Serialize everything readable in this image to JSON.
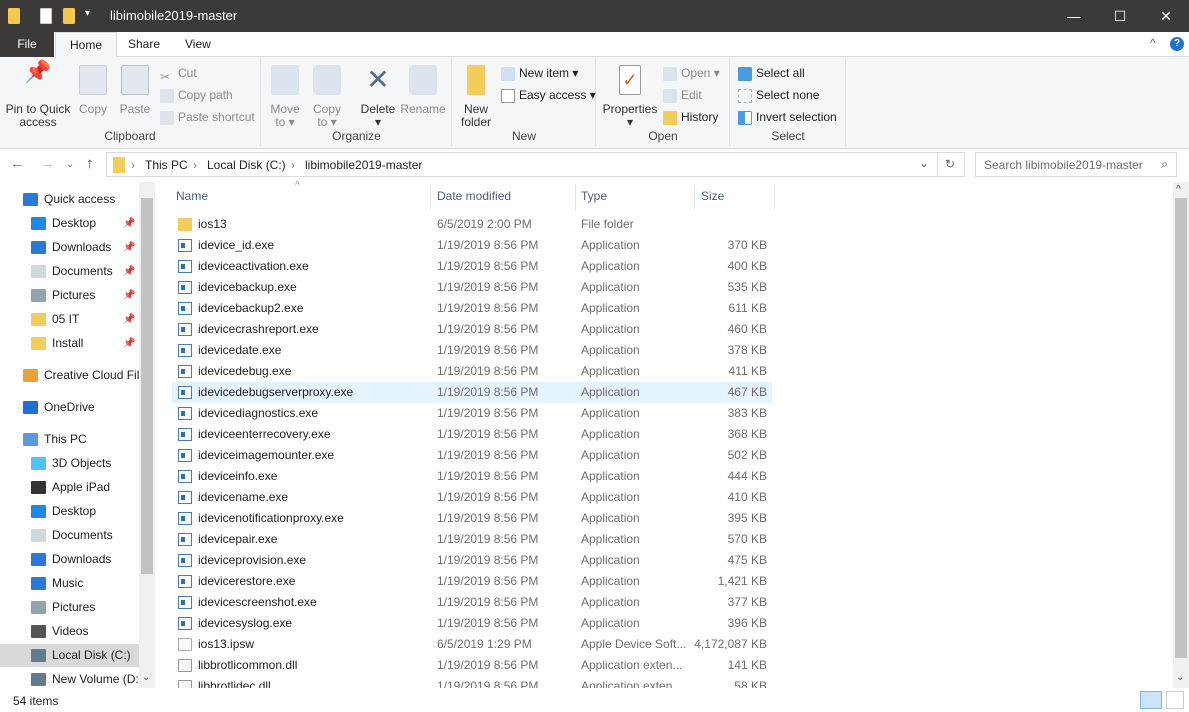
{
  "window": {
    "title": "libimobile2019-master",
    "minimize": "—",
    "maximize": "☐",
    "close": "✕"
  },
  "tabs": [
    {
      "label": "File"
    },
    {
      "label": "Home"
    },
    {
      "label": "Share"
    },
    {
      "label": "View"
    }
  ],
  "ribbon": {
    "clipboard": {
      "label": "Clipboard",
      "pin": "Pin to Quick access",
      "pin1": "Pin to Quick",
      "pin2": "access",
      "copy": "Copy",
      "paste": "Paste",
      "cut": "Cut",
      "copy_path": "Copy path",
      "paste_shortcut": "Paste shortcut"
    },
    "organize": {
      "label": "Organize",
      "move1": "Move",
      "move2": "to ▾",
      "copy1": "Copy",
      "copy2": "to ▾",
      "delete": "Delete",
      "delete_arrow": "▾",
      "rename": "Rename"
    },
    "new": {
      "label": "New",
      "folder1": "New",
      "folder2": "folder",
      "new_item": "New item ▾",
      "easy_access": "Easy access ▾"
    },
    "open": {
      "label": "Open",
      "properties": "Properties",
      "properties_arrow": "▾",
      "open": "Open ▾",
      "edit": "Edit",
      "history": "History"
    },
    "select": {
      "label": "Select",
      "all": "Select all",
      "none": "Select none",
      "invert": "Invert selection"
    }
  },
  "address": {
    "crumbs": [
      "This PC",
      "Local Disk (C:)",
      "libimobile2019-master"
    ],
    "sep": "›"
  },
  "search": {
    "placeholder": "Search libimobile2019-master"
  },
  "sidebar": [
    {
      "label": "Quick access",
      "icon": "star-icon",
      "color": "#2b7bd6"
    },
    {
      "label": "Desktop",
      "icon": "desktop-icon",
      "pinned": true,
      "color": "#1e88e5"
    },
    {
      "label": "Downloads",
      "icon": "download-icon",
      "pinned": true,
      "color": "#2b7bd6"
    },
    {
      "label": "Documents",
      "icon": "document-icon",
      "pinned": true,
      "color": "#cfd8dc"
    },
    {
      "label": "Pictures",
      "icon": "pictures-icon",
      "pinned": true,
      "color": "#90a4ae"
    },
    {
      "label": "05 IT",
      "icon": "folder-icon",
      "pinned": true,
      "color": "#f3cd5b"
    },
    {
      "label": "Install",
      "icon": "folder-icon",
      "pinned": true,
      "color": "#f3cd5b"
    },
    {
      "label": "Creative Cloud Files",
      "icon": "creative-cloud-icon",
      "color": "#e8a33a"
    },
    {
      "label": "OneDrive",
      "icon": "cloud-icon",
      "color": "#1e6fd0"
    },
    {
      "label": "This PC",
      "icon": "computer-icon",
      "color": "#5a9bd8"
    },
    {
      "label": "3D Objects",
      "icon": "cube-icon",
      "color": "#4fc3f7"
    },
    {
      "label": "Apple iPad",
      "icon": "tablet-icon",
      "color": "#333333"
    },
    {
      "label": "Desktop",
      "icon": "desktop-icon",
      "color": "#1e88e5"
    },
    {
      "label": "Documents",
      "icon": "document-icon",
      "color": "#cfd8dc"
    },
    {
      "label": "Downloads",
      "icon": "download-icon",
      "color": "#2b7bd6"
    },
    {
      "label": "Music",
      "icon": "music-icon",
      "color": "#2b7bd6"
    },
    {
      "label": "Pictures",
      "icon": "pictures-icon",
      "color": "#90a4ae"
    },
    {
      "label": "Videos",
      "icon": "video-icon",
      "color": "#555555"
    },
    {
      "label": "Local Disk (C:)",
      "icon": "drive-icon",
      "selected": true,
      "color": "#607d8b"
    },
    {
      "label": "New Volume (D:)",
      "icon": "drive-icon",
      "color": "#607d8b"
    }
  ],
  "columns": {
    "name": "Name",
    "date": "Date modified",
    "type": "Type",
    "size": "Size"
  },
  "files": [
    {
      "name": "ios13",
      "date": "6/5/2019 2:00 PM",
      "type": "File folder",
      "size": "",
      "icon": "folder"
    },
    {
      "name": "idevice_id.exe",
      "date": "1/19/2019 8:56 PM",
      "type": "Application",
      "size": "370 KB",
      "icon": "exe"
    },
    {
      "name": "ideviceactivation.exe",
      "date": "1/19/2019 8:56 PM",
      "type": "Application",
      "size": "400 KB",
      "icon": "exe"
    },
    {
      "name": "idevicebackup.exe",
      "date": "1/19/2019 8:56 PM",
      "type": "Application",
      "size": "535 KB",
      "icon": "exe"
    },
    {
      "name": "idevicebackup2.exe",
      "date": "1/19/2019 8:56 PM",
      "type": "Application",
      "size": "611 KB",
      "icon": "exe"
    },
    {
      "name": "idevicecrashreport.exe",
      "date": "1/19/2019 8:56 PM",
      "type": "Application",
      "size": "460 KB",
      "icon": "exe"
    },
    {
      "name": "idevicedate.exe",
      "date": "1/19/2019 8:56 PM",
      "type": "Application",
      "size": "378 KB",
      "icon": "exe"
    },
    {
      "name": "idevicedebug.exe",
      "date": "1/19/2019 8:56 PM",
      "type": "Application",
      "size": "411 KB",
      "icon": "exe"
    },
    {
      "name": "idevicedebugserverproxy.exe",
      "date": "1/19/2019 8:56 PM",
      "type": "Application",
      "size": "467 KB",
      "icon": "exe",
      "hover": true
    },
    {
      "name": "idevicediagnostics.exe",
      "date": "1/19/2019 8:56 PM",
      "type": "Application",
      "size": "383 KB",
      "icon": "exe"
    },
    {
      "name": "ideviceenterrecovery.exe",
      "date": "1/19/2019 8:56 PM",
      "type": "Application",
      "size": "368 KB",
      "icon": "exe"
    },
    {
      "name": "ideviceimagemounter.exe",
      "date": "1/19/2019 8:56 PM",
      "type": "Application",
      "size": "502 KB",
      "icon": "exe"
    },
    {
      "name": "ideviceinfo.exe",
      "date": "1/19/2019 8:56 PM",
      "type": "Application",
      "size": "444 KB",
      "icon": "exe"
    },
    {
      "name": "idevicename.exe",
      "date": "1/19/2019 8:56 PM",
      "type": "Application",
      "size": "410 KB",
      "icon": "exe"
    },
    {
      "name": "idevicenotificationproxy.exe",
      "date": "1/19/2019 8:56 PM",
      "type": "Application",
      "size": "395 KB",
      "icon": "exe"
    },
    {
      "name": "idevicepair.exe",
      "date": "1/19/2019 8:56 PM",
      "type": "Application",
      "size": "570 KB",
      "icon": "exe"
    },
    {
      "name": "ideviceprovision.exe",
      "date": "1/19/2019 8:56 PM",
      "type": "Application",
      "size": "475 KB",
      "icon": "exe"
    },
    {
      "name": "idevicerestore.exe",
      "date": "1/19/2019 8:56 PM",
      "type": "Application",
      "size": "1,421 KB",
      "icon": "exe"
    },
    {
      "name": "idevicescreenshot.exe",
      "date": "1/19/2019 8:56 PM",
      "type": "Application",
      "size": "377 KB",
      "icon": "exe"
    },
    {
      "name": "idevicesyslog.exe",
      "date": "1/19/2019 8:56 PM",
      "type": "Application",
      "size": "396 KB",
      "icon": "exe"
    },
    {
      "name": "ios13.ipsw",
      "date": "6/5/2019 1:29 PM",
      "type": "Apple Device Soft...",
      "size": "4,172,087 KB",
      "icon": "ipsw"
    },
    {
      "name": "libbrotlicommon.dll",
      "date": "1/19/2019 8:56 PM",
      "type": "Application exten...",
      "size": "141 KB",
      "icon": "dll"
    },
    {
      "name": "libbrotlidec.dll",
      "date": "1/19/2019 8:56 PM",
      "type": "Application exten...",
      "size": "58 KB",
      "icon": "dll"
    }
  ],
  "status": {
    "count": "54 items"
  }
}
